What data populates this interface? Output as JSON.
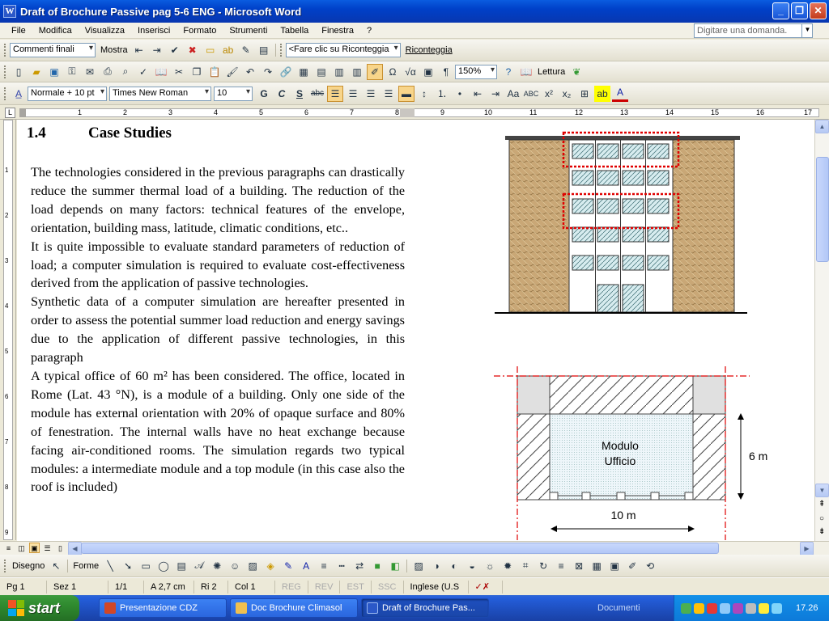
{
  "window": {
    "title": "Draft of Brochure Passive pag 5-6 ENG - Microsoft Word",
    "app_icon": "W"
  },
  "menu": {
    "items": [
      "File",
      "Modifica",
      "Visualizza",
      "Inserisci",
      "Formato",
      "Strumenti",
      "Tabella",
      "Finestra",
      "?"
    ],
    "ask_placeholder": "Digitare una domanda."
  },
  "reviewing_toolbar": {
    "display_combo": "Commenti finali",
    "show_label": "Mostra",
    "reconnect_combo": "<Fare clic su Riconteggia",
    "reconnect_label": "Riconteggia"
  },
  "standard_toolbar": {
    "zoom": "150%",
    "reading_label": "Lettura"
  },
  "format_toolbar": {
    "style": "Normale + 10 pt",
    "font": "Times New Roman",
    "size": "10",
    "bold": "G",
    "italic": "C",
    "underline": "S",
    "strike": "abc",
    "bullets": "ABC"
  },
  "ruler": {
    "h_numbers": [
      "1",
      "2",
      "3",
      "4",
      "5",
      "6",
      "7",
      "8",
      "9",
      "10",
      "11",
      "12",
      "13",
      "14",
      "15",
      "16",
      "17"
    ],
    "v_numbers": [
      "1",
      "2",
      "3",
      "4",
      "5",
      "6",
      "7",
      "8",
      "9"
    ]
  },
  "document": {
    "heading_number": "1.4",
    "heading_text": "Case Studies",
    "paragraphs": [
      "The technologies considered in the previous paragraphs can drastically reduce the summer thermal load of a building. The reduction of the load depends on many factors: technical features of the envelope, orientation, building mass, latitude, climatic conditions, etc..",
      "It is quite impossible to evaluate standard parameters of reduction of load; a computer simulation is required to evaluate cost-effectiveness derived from the application of passive technologies.",
      "Synthetic data of a computer simulation are hereafter presented in order to assess the potential summer load reduction and energy savings due to the application of different passive technologies, in this paragraph",
      "A typical office of 60 m² has been considered. The office, located in Rome (Lat. 43 °N), is a module  of a building.  Only one side of the module has external orientation with 20% of opaque surface and 80% of fenestration. The internal walls have no heat exchange because facing air-conditioned rooms. The simulation regards two typical modules: a intermediate module and a top module (in this case also the roof is included)"
    ],
    "plan_label_line1": "Modulo",
    "plan_label_line2": "Ufficio",
    "plan_depth": "6 m",
    "plan_width": "10 m"
  },
  "drawing_toolbar": {
    "draw_label": "Disegno",
    "shapes_label": "Forme"
  },
  "status": {
    "page": "Pg  1",
    "section": "Sez  1",
    "pages": "1/1",
    "at": "A  2,7 cm",
    "line": "Ri  2",
    "col": "Col  1",
    "rec": "REG",
    "trk": "REV",
    "ext": "EST",
    "ovr": "SSC",
    "language": "Inglese (U.S"
  },
  "taskbar": {
    "start": "start",
    "tasks": [
      "Presentazione CDZ",
      "Doc Brochure Climasol",
      "Draft of Brochure Pas..."
    ],
    "documents": "Documenti",
    "time": "17.26"
  },
  "colors": {
    "titlebar": "#0a5ce0",
    "taskbar": "#245edb",
    "start": "#2f8a2f",
    "plan_dash": "#e00000"
  }
}
